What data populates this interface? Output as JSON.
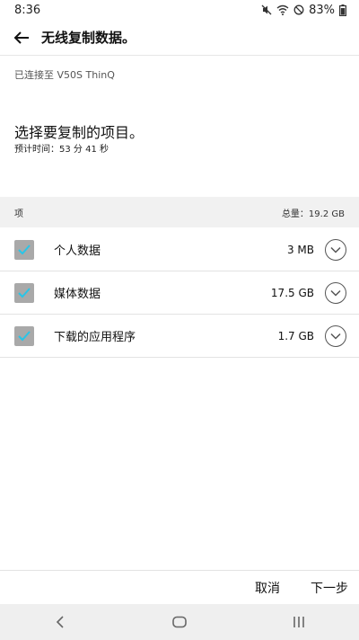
{
  "status_bar": {
    "time": "8:36",
    "battery": "83%",
    "icons": [
      "mute-icon",
      "wifi-icon",
      "do-not-disturb-icon",
      "battery-icon"
    ]
  },
  "app_bar": {
    "title": "无线复制数据。",
    "back_icon": "back-arrow-icon"
  },
  "connection": {
    "text": "已连接至 V50S ThinQ"
  },
  "main": {
    "heading": "选择要复制的项目。",
    "estimate": "预计时间：53 分 41 秒"
  },
  "table": {
    "header_label": "项",
    "total": "总量：19.2 GB",
    "items": [
      {
        "label": "个人数据",
        "size": "3 MB",
        "checked": true
      },
      {
        "label": "媒体数据",
        "size": "17.5 GB",
        "checked": true
      },
      {
        "label": "下载的应用程序",
        "size": "1.7 GB",
        "checked": true
      }
    ]
  },
  "actions": {
    "cancel_label": "取消",
    "next_label": "下一步"
  },
  "nav_bar": {
    "icons": [
      "nav-back-icon",
      "nav-home-icon",
      "nav-recents-icon"
    ]
  },
  "colors": {
    "check_mark": "#29c5e8",
    "checkbox_fill": "#a9a9a9",
    "header_bg": "#f1f1f1",
    "nav_bg": "#efefef"
  }
}
